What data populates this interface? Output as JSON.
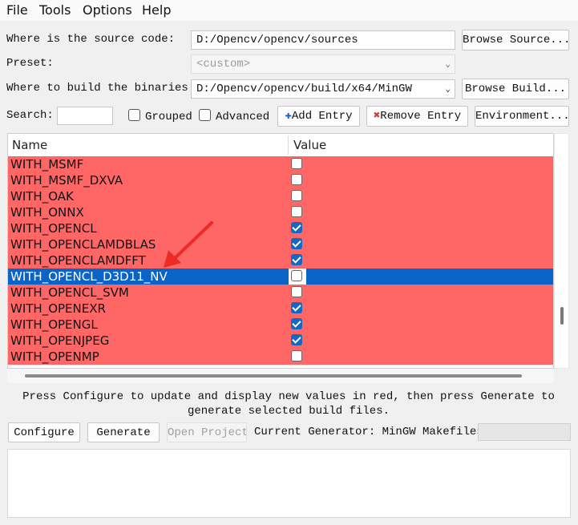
{
  "menu": [
    "File",
    "Tools",
    "Options",
    "Help"
  ],
  "source": {
    "label": "Where is the source code:",
    "value": "D:/Opencv/opencv/sources",
    "browse": "Browse Source..."
  },
  "preset": {
    "label": "Preset:",
    "value": "<custom>"
  },
  "build": {
    "label": "Where to build the binaries:",
    "value": "D:/Opencv/opencv/build/x64/MinGW",
    "browse": "Browse Build..."
  },
  "toolbar": {
    "search_label": "Search:",
    "search_value": "",
    "grouped": "Grouped",
    "grouped_checked": false,
    "advanced": "Advanced",
    "advanced_checked": false,
    "add_entry": "Add Entry",
    "remove_entry": "Remove Entry",
    "environment": "Environment..."
  },
  "table": {
    "headers": [
      "Name",
      "Value"
    ],
    "row_color": "#ff6666",
    "selected_color": "#0a64c8",
    "rows": [
      {
        "name": "WITH_MSMF",
        "checked": false
      },
      {
        "name": "WITH_MSMF_DXVA",
        "checked": false
      },
      {
        "name": "WITH_OAK",
        "checked": false
      },
      {
        "name": "WITH_ONNX",
        "checked": false
      },
      {
        "name": "WITH_OPENCL",
        "checked": true
      },
      {
        "name": "WITH_OPENCLAMDBLAS",
        "checked": true
      },
      {
        "name": "WITH_OPENCLAMDFFT",
        "checked": true
      },
      {
        "name": "WITH_OPENCL_D3D11_NV",
        "checked": false,
        "selected": true
      },
      {
        "name": "WITH_OPENCL_SVM",
        "checked": false
      },
      {
        "name": "WITH_OPENEXR",
        "checked": true
      },
      {
        "name": "WITH_OPENGL",
        "checked": true
      },
      {
        "name": "WITH_OPENJPEG",
        "checked": true
      },
      {
        "name": "WITH_OPENMP",
        "checked": false
      }
    ]
  },
  "message": {
    "line1": "Press Configure to update and display new values in red, then press Generate to",
    "line2": "generate selected build files."
  },
  "bottom": {
    "configure": "Configure",
    "generate": "Generate",
    "open_project": "Open Project",
    "current_generator_label": "Current Generator: MinGW Makefiles"
  },
  "annotation": {
    "arrow_color": "#ee2a24"
  }
}
